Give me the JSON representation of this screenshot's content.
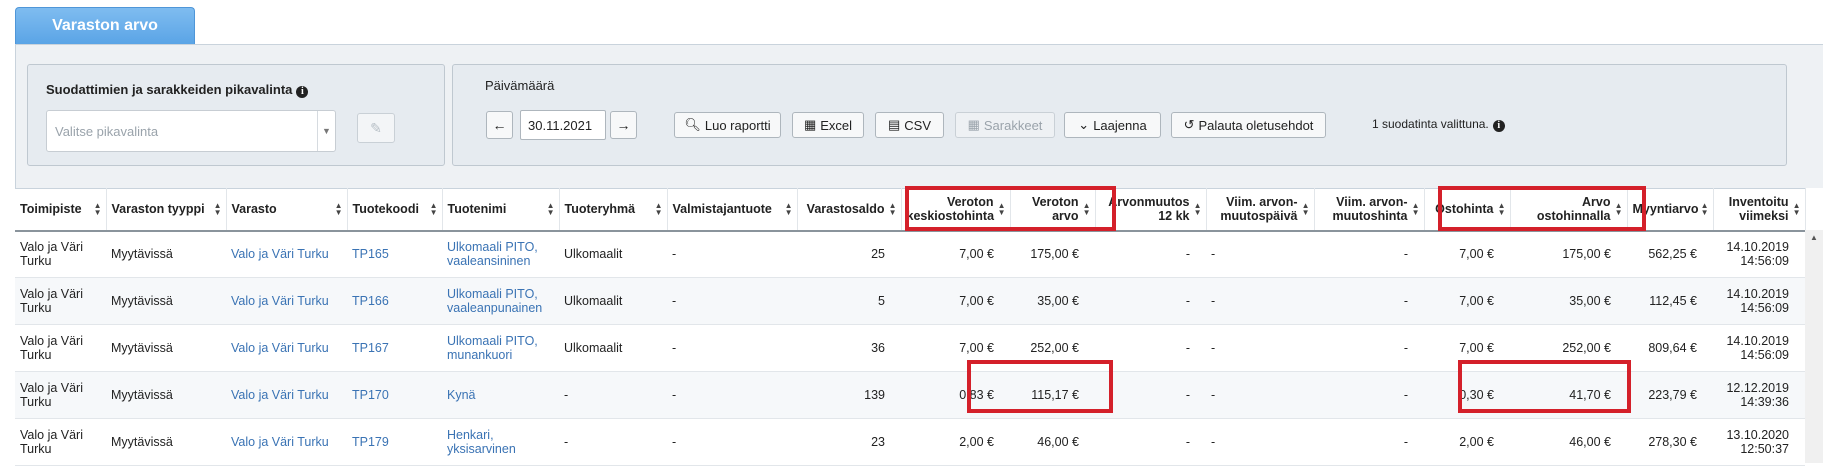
{
  "tab": {
    "label": "Varaston arvo"
  },
  "quickselect": {
    "title": "Suodattimien ja sarakkeiden pikavalinta",
    "placeholder": "Valitse pikavalinta"
  },
  "date": {
    "label": "Päivämäärä",
    "value": "30.11.2021"
  },
  "toolbar": {
    "report": "Luo raportti",
    "excel": "Excel",
    "csv": "CSV",
    "columns": "Sarakkeet",
    "expand": "Laajenna",
    "reset": "Palauta oletusehdot",
    "filter_status": "1 suodatinta valittuna."
  },
  "columns": [
    "Toimipiste",
    "Varaston tyyppi",
    "Varasto",
    "Tuotekoodi",
    "Tuotenimi",
    "Tuoteryhmä",
    "Valmistajantuote",
    "Varastosaldo",
    "Veroton keskiostohinta",
    "Veroton arvo",
    "Arvonmuutos 12 kk",
    "Viim. arvon-muutospäivä",
    "Viim. arvon-muutoshinta",
    "Ostohinta",
    "Arvo ostohinnalla",
    "Myyntiarvo",
    "Inventoitu viimeksi"
  ],
  "rows": [
    [
      "Valo ja Väri Turku",
      "Myytävissä",
      "Valo ja Väri Turku",
      "TP165",
      "Ulkomaali PITO, vaaleansininen",
      "Ulkomaalit",
      "-",
      "25",
      "7,00 €",
      "175,00 €",
      "-",
      "-",
      "-",
      "7,00 €",
      "175,00 €",
      "562,25 €",
      "14.10.2019 14:56:09"
    ],
    [
      "Valo ja Väri Turku",
      "Myytävissä",
      "Valo ja Väri Turku",
      "TP166",
      "Ulkomaali PITO, vaaleanpunainen",
      "Ulkomaalit",
      "-",
      "5",
      "7,00 €",
      "35,00 €",
      "-",
      "-",
      "-",
      "7,00 €",
      "35,00 €",
      "112,45 €",
      "14.10.2019 14:56:09"
    ],
    [
      "Valo ja Väri Turku",
      "Myytävissä",
      "Valo ja Väri Turku",
      "TP167",
      "Ulkomaali PITO, munankuori",
      "Ulkomaalit",
      "-",
      "36",
      "7,00 €",
      "252,00 €",
      "-",
      "-",
      "-",
      "7,00 €",
      "252,00 €",
      "809,64 €",
      "14.10.2019 14:56:09"
    ],
    [
      "Valo ja Väri Turku",
      "Myytävissä",
      "Valo ja Väri Turku",
      "TP170",
      "Kynä",
      "-",
      "-",
      "139",
      "0,83 €",
      "115,17 €",
      "-",
      "-",
      "-",
      "0,30 €",
      "41,70 €",
      "223,79 €",
      "12.12.2019 14:39:36"
    ],
    [
      "Valo ja Väri Turku",
      "Myytävissä",
      "Valo ja Väri Turku",
      "TP179",
      "Henkari, yksisarvinen",
      "-",
      "-",
      "23",
      "2,00 €",
      "46,00 €",
      "-",
      "-",
      "-",
      "2,00 €",
      "46,00 €",
      "278,30 €",
      "13.10.2020 12:50:37"
    ]
  ],
  "highlight_color": "#d4202a"
}
